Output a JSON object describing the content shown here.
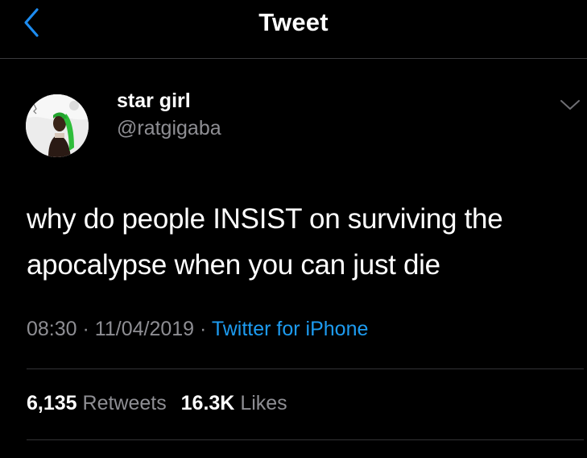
{
  "nav": {
    "title": "Tweet",
    "back_icon": "chevron-left-icon"
  },
  "author": {
    "display_name": "star girl",
    "handle": "@ratgigaba",
    "menu_icon": "chevron-down-icon"
  },
  "tweet": {
    "text_line1": "why do people INSIST on surviving the",
    "text_line2": "apocalypse when you can just die",
    "time": "08:30",
    "separator": "·",
    "date": "11/04/2019",
    "source": "Twitter for iPhone"
  },
  "stats": {
    "retweets_count": "6,135",
    "retweets_label": "Retweets",
    "likes_count": "16.3K",
    "likes_label": "Likes"
  },
  "colors": {
    "background": "#000000",
    "link": "#1d9bf0",
    "secondary_text": "#8e8e93",
    "back_icon": "#1d8cf0"
  }
}
